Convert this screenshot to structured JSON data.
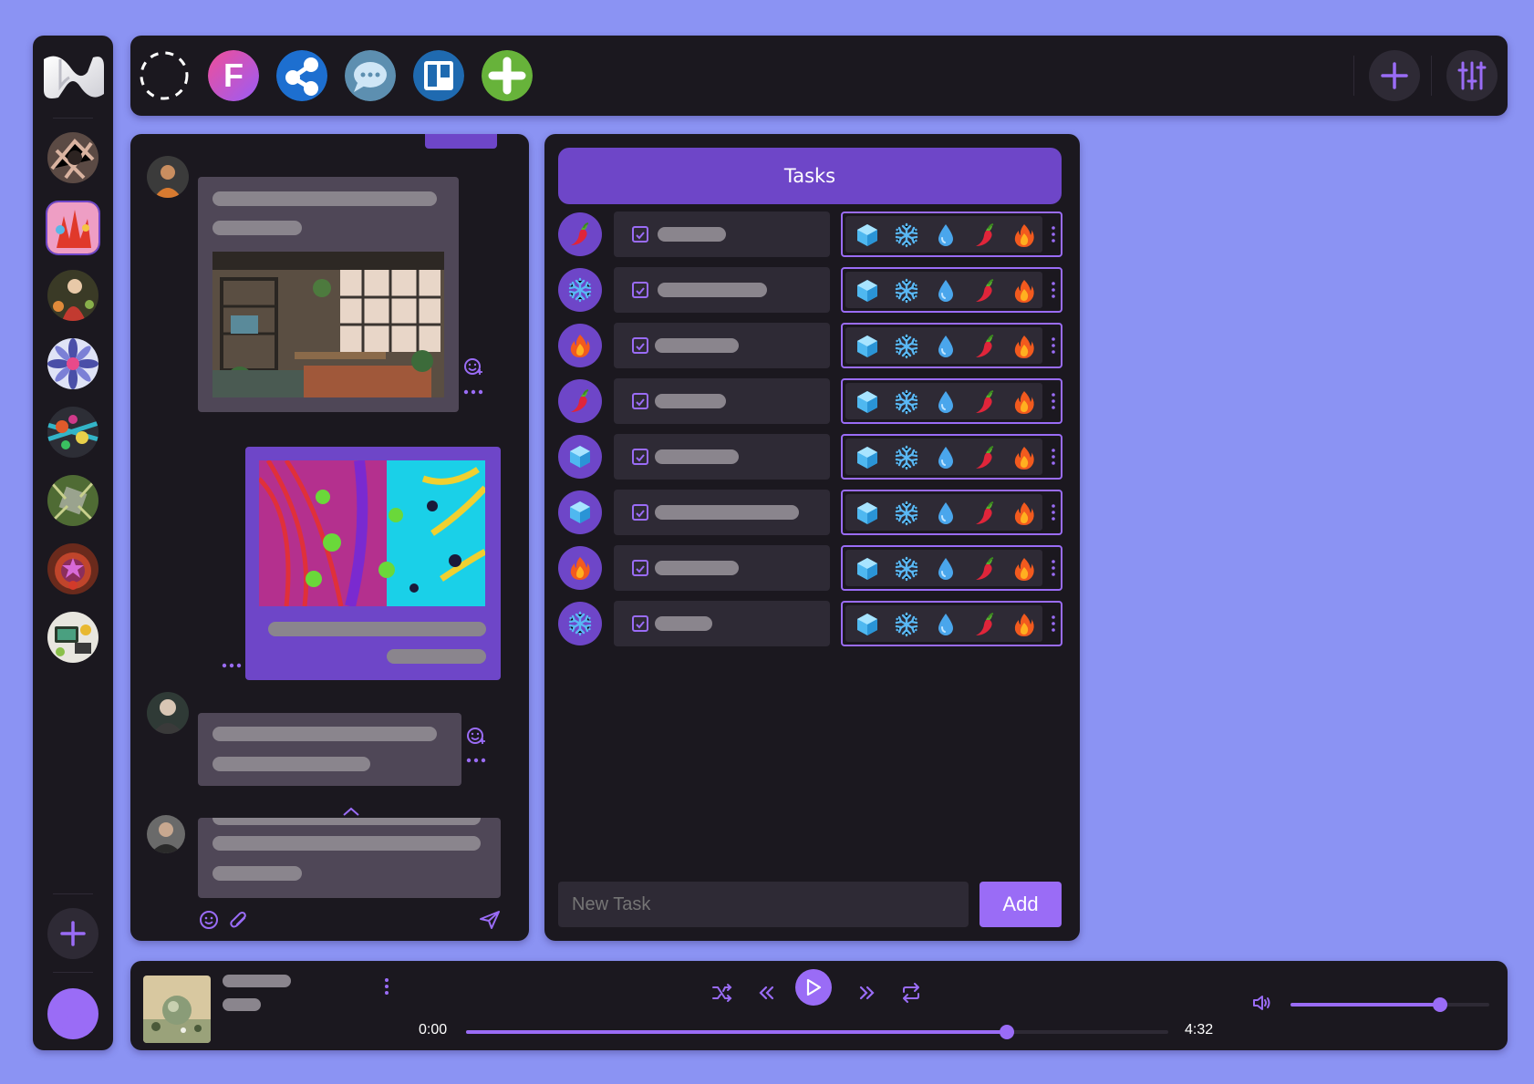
{
  "colors": {
    "background": "#8b93f3",
    "panel": "#1b181f",
    "surface": "#2e2a35",
    "accent": "#6e46c8",
    "accent_light": "#9a6cf6",
    "skeleton": "#8a858d"
  },
  "rail": {
    "logo_icon": "stylized-n-logo-icon",
    "rooms": [
      "room-avatar-1",
      "room-avatar-2",
      "room-avatar-3",
      "room-avatar-4",
      "room-avatar-5",
      "room-avatar-6",
      "room-avatar-7",
      "room-avatar-8"
    ],
    "selected_room": 1,
    "add_icon": "plus-icon",
    "user_icon": "user-icon"
  },
  "topbar": {
    "apps": [
      "dashed-circle-icon",
      "f-app-icon",
      "share-app-icon",
      "chat-app-icon",
      "board-app-icon",
      "add-app-icon"
    ],
    "f_app_letter": "F",
    "right_buttons": [
      "plus-icon",
      "sliders-icon"
    ]
  },
  "tasks": {
    "title": "Tasks",
    "rows": [
      {
        "icon": "pepper"
      },
      {
        "icon": "snowflake"
      },
      {
        "icon": "fire"
      },
      {
        "icon": "pepper"
      },
      {
        "icon": "ice"
      },
      {
        "icon": "ice"
      },
      {
        "icon": "fire"
      },
      {
        "icon": "snowflake"
      }
    ],
    "picker_icons": [
      "ice-cube-icon",
      "snowflake-icon",
      "droplet-icon",
      "pepper-icon",
      "fire-icon"
    ],
    "new_task_placeholder": "New Task",
    "add_label": "Add"
  },
  "player": {
    "time_current": "0:00",
    "time_total": "4:32",
    "progress": 0.77,
    "volume": 0.75
  }
}
